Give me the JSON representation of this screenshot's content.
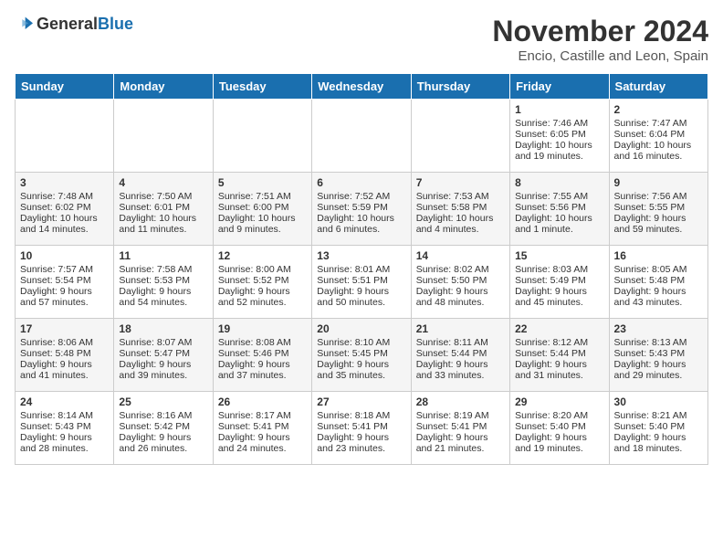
{
  "header": {
    "logo_general": "General",
    "logo_blue": "Blue",
    "month_title": "November 2024",
    "location": "Encio, Castille and Leon, Spain"
  },
  "weekdays": [
    "Sunday",
    "Monday",
    "Tuesday",
    "Wednesday",
    "Thursday",
    "Friday",
    "Saturday"
  ],
  "weeks": [
    [
      {
        "day": "",
        "info": ""
      },
      {
        "day": "",
        "info": ""
      },
      {
        "day": "",
        "info": ""
      },
      {
        "day": "",
        "info": ""
      },
      {
        "day": "",
        "info": ""
      },
      {
        "day": "1",
        "info": "Sunrise: 7:46 AM\nSunset: 6:05 PM\nDaylight: 10 hours and 19 minutes."
      },
      {
        "day": "2",
        "info": "Sunrise: 7:47 AM\nSunset: 6:04 PM\nDaylight: 10 hours and 16 minutes."
      }
    ],
    [
      {
        "day": "3",
        "info": "Sunrise: 7:48 AM\nSunset: 6:02 PM\nDaylight: 10 hours and 14 minutes."
      },
      {
        "day": "4",
        "info": "Sunrise: 7:50 AM\nSunset: 6:01 PM\nDaylight: 10 hours and 11 minutes."
      },
      {
        "day": "5",
        "info": "Sunrise: 7:51 AM\nSunset: 6:00 PM\nDaylight: 10 hours and 9 minutes."
      },
      {
        "day": "6",
        "info": "Sunrise: 7:52 AM\nSunset: 5:59 PM\nDaylight: 10 hours and 6 minutes."
      },
      {
        "day": "7",
        "info": "Sunrise: 7:53 AM\nSunset: 5:58 PM\nDaylight: 10 hours and 4 minutes."
      },
      {
        "day": "8",
        "info": "Sunrise: 7:55 AM\nSunset: 5:56 PM\nDaylight: 10 hours and 1 minute."
      },
      {
        "day": "9",
        "info": "Sunrise: 7:56 AM\nSunset: 5:55 PM\nDaylight: 9 hours and 59 minutes."
      }
    ],
    [
      {
        "day": "10",
        "info": "Sunrise: 7:57 AM\nSunset: 5:54 PM\nDaylight: 9 hours and 57 minutes."
      },
      {
        "day": "11",
        "info": "Sunrise: 7:58 AM\nSunset: 5:53 PM\nDaylight: 9 hours and 54 minutes."
      },
      {
        "day": "12",
        "info": "Sunrise: 8:00 AM\nSunset: 5:52 PM\nDaylight: 9 hours and 52 minutes."
      },
      {
        "day": "13",
        "info": "Sunrise: 8:01 AM\nSunset: 5:51 PM\nDaylight: 9 hours and 50 minutes."
      },
      {
        "day": "14",
        "info": "Sunrise: 8:02 AM\nSunset: 5:50 PM\nDaylight: 9 hours and 48 minutes."
      },
      {
        "day": "15",
        "info": "Sunrise: 8:03 AM\nSunset: 5:49 PM\nDaylight: 9 hours and 45 minutes."
      },
      {
        "day": "16",
        "info": "Sunrise: 8:05 AM\nSunset: 5:48 PM\nDaylight: 9 hours and 43 minutes."
      }
    ],
    [
      {
        "day": "17",
        "info": "Sunrise: 8:06 AM\nSunset: 5:48 PM\nDaylight: 9 hours and 41 minutes."
      },
      {
        "day": "18",
        "info": "Sunrise: 8:07 AM\nSunset: 5:47 PM\nDaylight: 9 hours and 39 minutes."
      },
      {
        "day": "19",
        "info": "Sunrise: 8:08 AM\nSunset: 5:46 PM\nDaylight: 9 hours and 37 minutes."
      },
      {
        "day": "20",
        "info": "Sunrise: 8:10 AM\nSunset: 5:45 PM\nDaylight: 9 hours and 35 minutes."
      },
      {
        "day": "21",
        "info": "Sunrise: 8:11 AM\nSunset: 5:44 PM\nDaylight: 9 hours and 33 minutes."
      },
      {
        "day": "22",
        "info": "Sunrise: 8:12 AM\nSunset: 5:44 PM\nDaylight: 9 hours and 31 minutes."
      },
      {
        "day": "23",
        "info": "Sunrise: 8:13 AM\nSunset: 5:43 PM\nDaylight: 9 hours and 29 minutes."
      }
    ],
    [
      {
        "day": "24",
        "info": "Sunrise: 8:14 AM\nSunset: 5:43 PM\nDaylight: 9 hours and 28 minutes."
      },
      {
        "day": "25",
        "info": "Sunrise: 8:16 AM\nSunset: 5:42 PM\nDaylight: 9 hours and 26 minutes."
      },
      {
        "day": "26",
        "info": "Sunrise: 8:17 AM\nSunset: 5:41 PM\nDaylight: 9 hours and 24 minutes."
      },
      {
        "day": "27",
        "info": "Sunrise: 8:18 AM\nSunset: 5:41 PM\nDaylight: 9 hours and 23 minutes."
      },
      {
        "day": "28",
        "info": "Sunrise: 8:19 AM\nSunset: 5:41 PM\nDaylight: 9 hours and 21 minutes."
      },
      {
        "day": "29",
        "info": "Sunrise: 8:20 AM\nSunset: 5:40 PM\nDaylight: 9 hours and 19 minutes."
      },
      {
        "day": "30",
        "info": "Sunrise: 8:21 AM\nSunset: 5:40 PM\nDaylight: 9 hours and 18 minutes."
      }
    ]
  ]
}
